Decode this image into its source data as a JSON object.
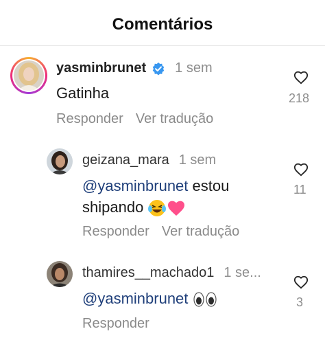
{
  "header": {
    "title": "Comentários"
  },
  "comments": [
    {
      "username": "yasminbrunet",
      "verified": true,
      "time": "1 sem",
      "text": "Gatinha",
      "reply_label": "Responder",
      "translate_label": "Ver tradução",
      "likes": "218"
    },
    {
      "username": "geizana_mara",
      "time": "1 sem",
      "mention": "@yasminbrunet",
      "text_after_mention": "estou",
      "text_line2": "shipando",
      "emojis": [
        "laughing-tears-emoji",
        "pink-heart-emoji"
      ],
      "reply_label": "Responder",
      "translate_label": "Ver tradução",
      "likes": "11"
    },
    {
      "username": "thamires__machado1",
      "time": "1 se...",
      "mention": "@yasminbrunet",
      "emojis": [
        "eyes-emoji"
      ],
      "reply_label": "Responder",
      "likes": "3"
    }
  ],
  "colors": {
    "mention": "#1f3f7a",
    "muted": "#8e8e8e",
    "verified": "#3897f0",
    "heart_pink": "#ff4f8b"
  }
}
